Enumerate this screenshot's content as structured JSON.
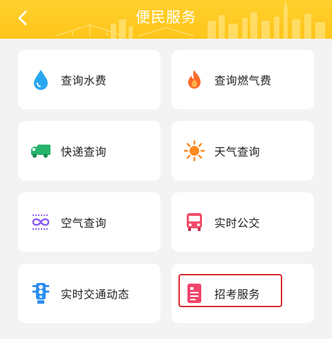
{
  "header": {
    "title": "便民服务",
    "background_color": "#ffc51a"
  },
  "services": [
    {
      "label": "查询水费",
      "icon": "water-drop-icon",
      "color": "#29a6f0"
    },
    {
      "label": "查询燃气费",
      "icon": "flame-icon",
      "color": "#ff6a2b"
    },
    {
      "label": "快递查询",
      "icon": "delivery-truck-icon",
      "color": "#26b36a"
    },
    {
      "label": "天气查询",
      "icon": "sun-icon",
      "color": "#ff8a1d"
    },
    {
      "label": "空气查询",
      "icon": "air-infinity-icon",
      "color": "#8a5cf0"
    },
    {
      "label": "实时公交",
      "icon": "bus-icon",
      "color": "#f24d6a"
    },
    {
      "label": "实时交通动态",
      "icon": "traffic-light-icon",
      "color": "#2f8ef0"
    },
    {
      "label": "招考服务",
      "icon": "exam-document-icon",
      "color": "#f2456b"
    }
  ],
  "highlight_color": "#d8262c"
}
